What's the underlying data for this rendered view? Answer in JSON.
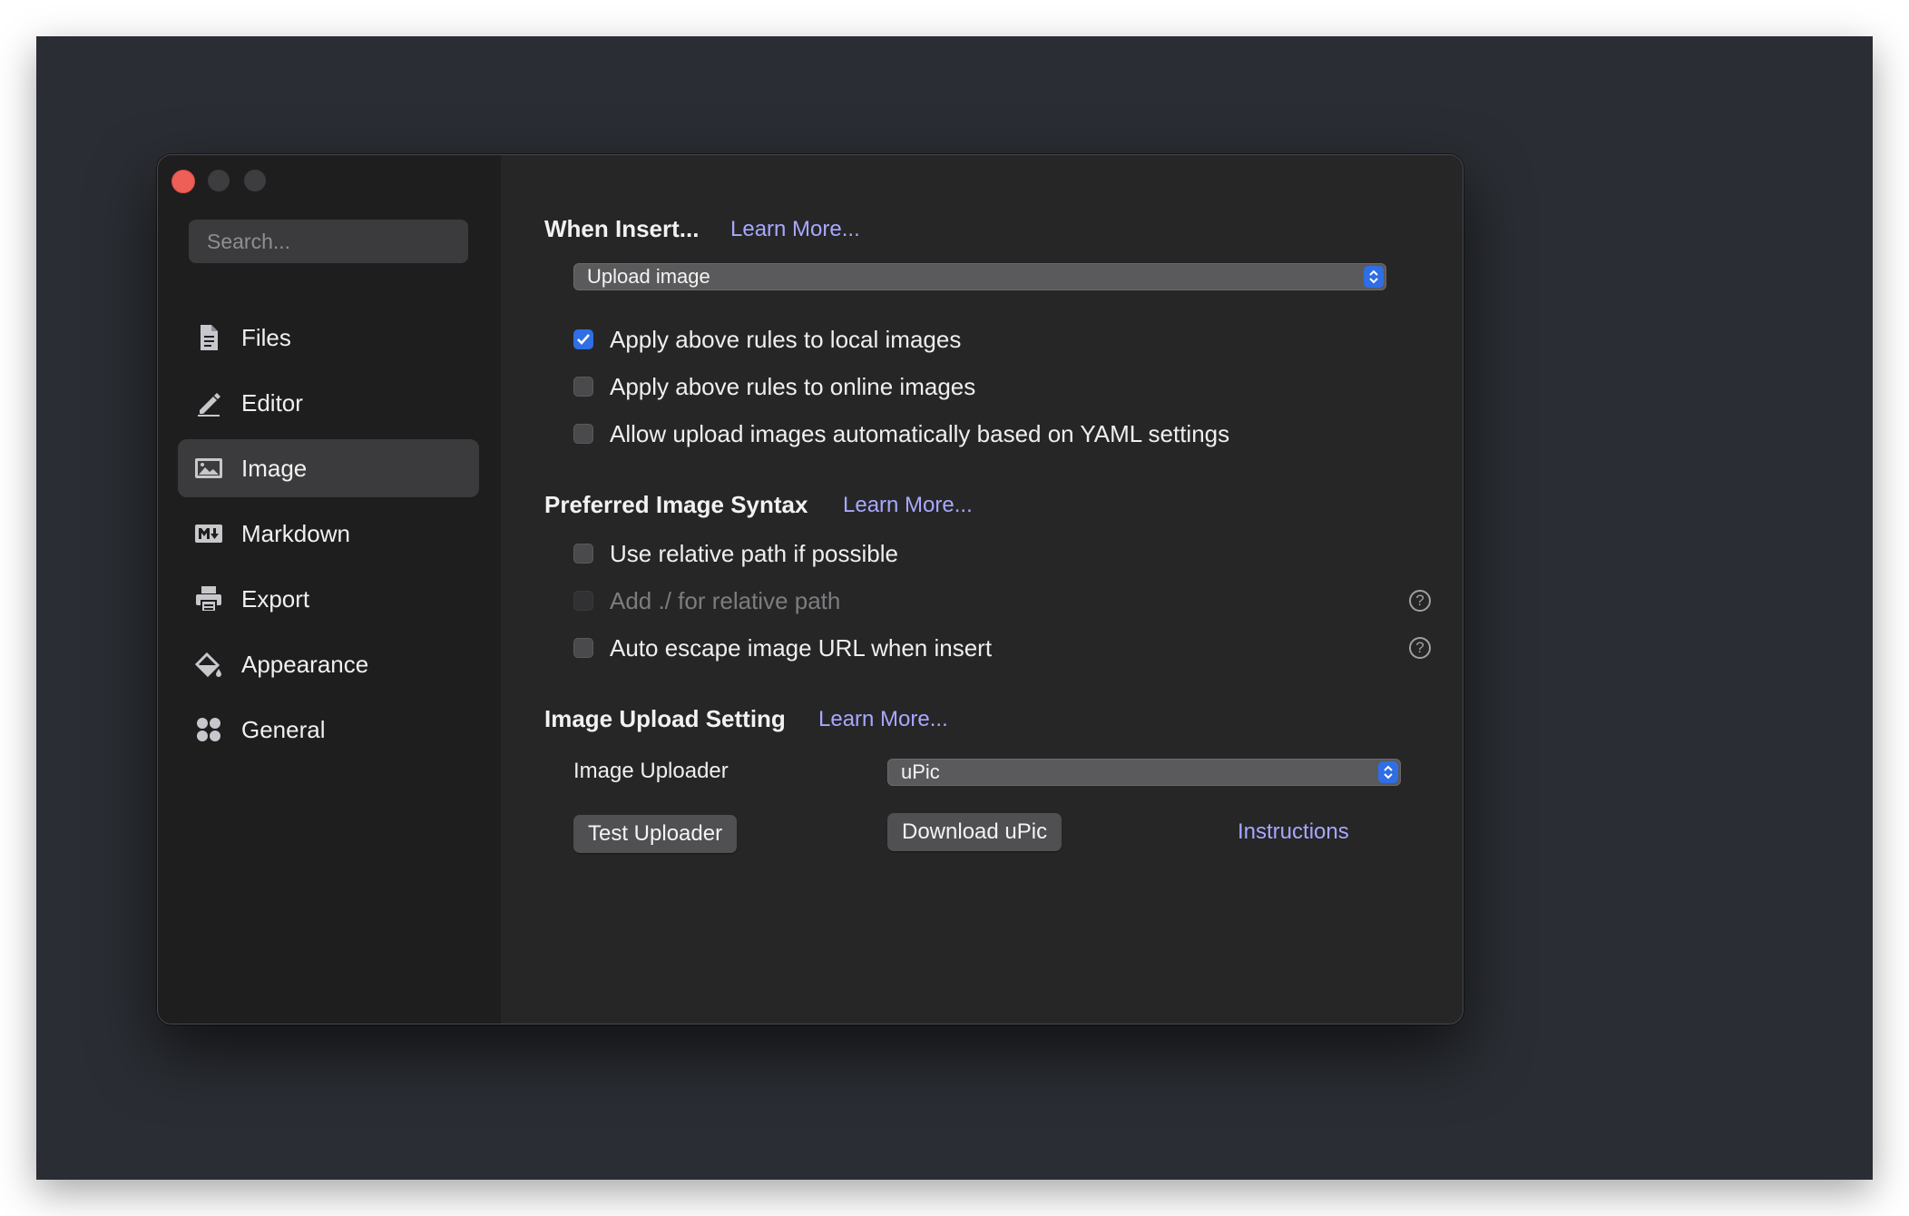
{
  "window": {
    "traffic_lights": [
      "close",
      "minimize",
      "maximize"
    ],
    "accent_color": "#2f6ee4",
    "link_color": "#a7a8ff"
  },
  "sidebar": {
    "search_placeholder": "Search...",
    "items": [
      {
        "label": "Files",
        "icon": "document-icon",
        "active": false
      },
      {
        "label": "Editor",
        "icon": "pencil-icon",
        "active": false
      },
      {
        "label": "Image",
        "icon": "image-icon",
        "active": true
      },
      {
        "label": "Markdown",
        "icon": "markdown-icon",
        "active": false
      },
      {
        "label": "Export",
        "icon": "printer-icon",
        "active": false
      },
      {
        "label": "Appearance",
        "icon": "paint-bucket-icon",
        "active": false
      },
      {
        "label": "General",
        "icon": "grid-icon",
        "active": false
      }
    ]
  },
  "when_insert": {
    "heading": "When Insert...",
    "learn_more": "Learn More...",
    "select_value": "Upload image",
    "options": [
      {
        "label": "Apply above rules to local images",
        "checked": true,
        "disabled": false
      },
      {
        "label": "Apply above rules to online images",
        "checked": false,
        "disabled": false
      },
      {
        "label": "Allow upload images automatically based on YAML settings",
        "checked": false,
        "disabled": false
      }
    ]
  },
  "syntax": {
    "heading": "Preferred Image Syntax",
    "learn_more": "Learn More...",
    "options": [
      {
        "label": "Use relative path if possible",
        "checked": false,
        "disabled": false,
        "help": false
      },
      {
        "label": "Add ./ for relative path",
        "checked": false,
        "disabled": true,
        "help": true
      },
      {
        "label": "Auto escape image URL when insert",
        "checked": false,
        "disabled": false,
        "help": true
      }
    ],
    "help_glyph": "?"
  },
  "upload": {
    "heading": "Image Upload Setting",
    "learn_more": "Learn More...",
    "uploader_label": "Image Uploader",
    "uploader_value": "uPic",
    "test_button": "Test Uploader",
    "download_button": "Download uPic",
    "instructions_link": "Instructions"
  }
}
